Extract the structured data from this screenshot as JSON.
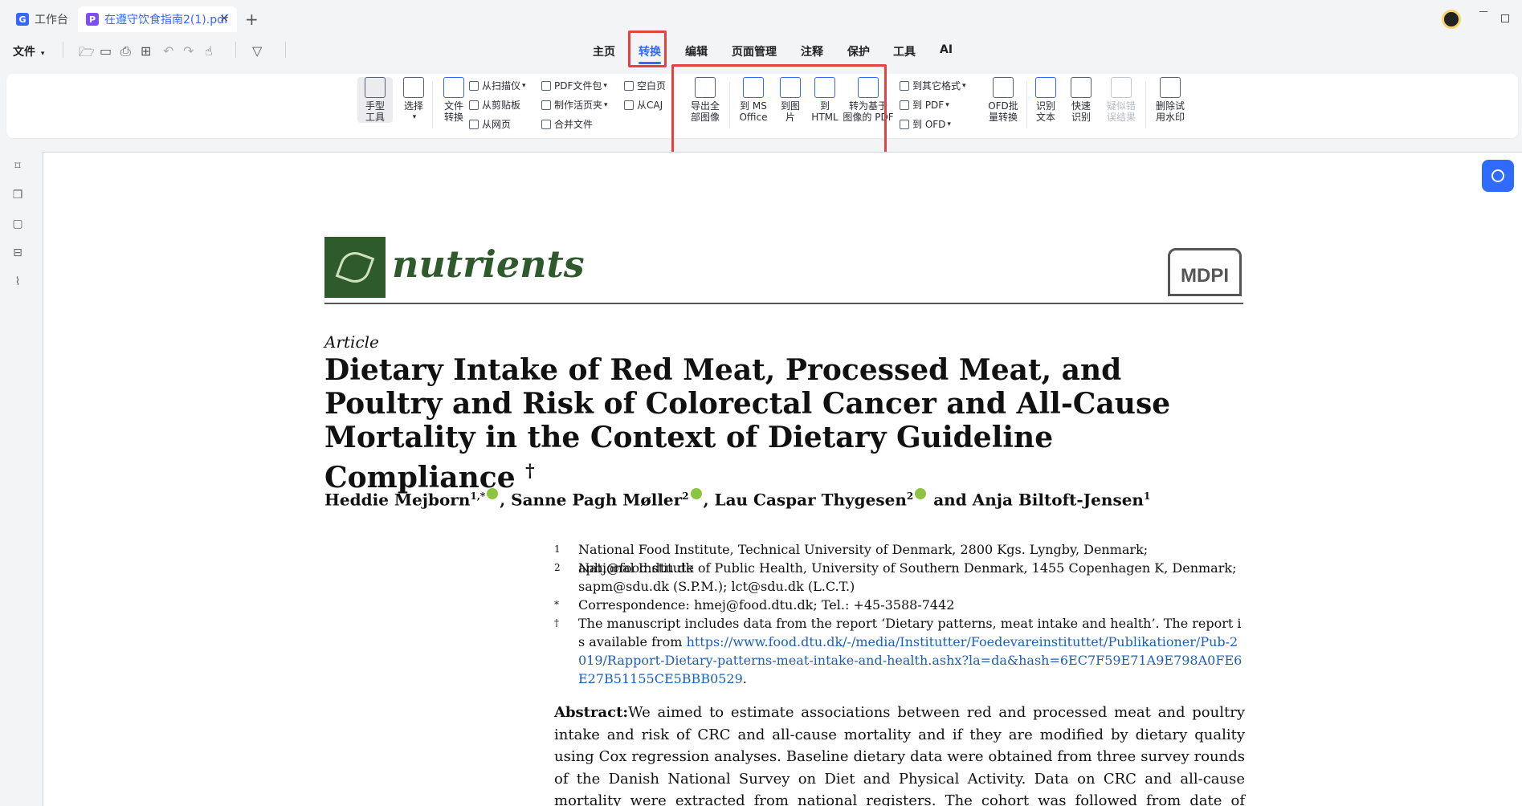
{
  "tabs": [
    {
      "label": "工作台"
    },
    {
      "label": "在遵守饮食指南2(1).pdf"
    }
  ],
  "tab_close": "×",
  "tab_add": "+",
  "menu": {
    "file_label": "文件",
    "tabs": [
      "主页",
      "转换",
      "编辑",
      "页面管理",
      "注释",
      "保护",
      "工具",
      "AI"
    ],
    "active_tab": "转换"
  },
  "ribbon": {
    "hand_tool": "手型\n工具",
    "select": "选择",
    "file_convert": "文件\n转换",
    "from_scanner": "从扫描仪",
    "from_clipboard": "从剪贴板",
    "from_webpage": "从网页",
    "pdf_portfolio": "PDF文件包",
    "make_active_page": "制作活页夹",
    "merge_files": "合并文件",
    "blank_page": "空白页",
    "from_caj": "从CAJ",
    "export_all_images": "导出全\n部图像",
    "to_ms_office": "到 MS\nOffice",
    "to_image": "到图\n片",
    "to_html": "到\nHTML",
    "to_image_pdf": "转为基于\n图像的 PDF",
    "to_other_formats": "到其它格式",
    "to_pdf": "到 PDF",
    "to_ofd": "到 OFD",
    "ofd_batch": "OFD批\n量转换",
    "ocr_text": "识别\n文本",
    "quick_ocr": "快速\n识别",
    "suspected_errors": "疑似错\n误结果",
    "remove_watermark": "删除试\n用水印"
  },
  "document": {
    "journal": "nutrients",
    "publisher": "MDPI",
    "article_type": "Article",
    "title": "Dietary Intake of Red Meat, Processed Meat, and Poultry and Risk of Colorectal Cancer and All-Cause Mortality in the Context of Dietary Guideline Compliance",
    "title_mark": "†",
    "authors": [
      {
        "name": "Heddie Mejborn",
        "sup": "1,*"
      },
      {
        "name": "Sanne Pagh Møller",
        "sup": "2"
      },
      {
        "name": "Lau Caspar Thygesen",
        "sup": "2"
      },
      {
        "name": "Anja Biltoft-Jensen",
        "sup": "1"
      }
    ],
    "author_sep": ", ",
    "author_and": " and ",
    "affiliations": [
      {
        "mark": "1",
        "text": "National Food Institute, Technical University of Denmark, 2800 Kgs. Lyngby, Denmark; apbj@food.dtu.dk"
      },
      {
        "mark": "2",
        "text": "National Institute of Public Health, University of Southern Denmark, 1455 Copenhagen K, Denmark; sapm@sdu.dk (S.P.M.); lct@sdu.dk (L.C.T.)"
      },
      {
        "mark": "*",
        "text": "Correspondence: hmej@food.dtu.dk; Tel.: +45-3588-7442"
      }
    ],
    "note_mark": "†",
    "note_text": "The manuscript includes data from the report ‘Dietary patterns, meat intake and health’. The report is available from ",
    "note_link": "https://www.food.dtu.dk/-/media/Institutter/Foedevareinstituttet/Publikationer/Pub-2019/Rapport-Dietary-patterns-meat-intake-and-health.ashx?la=da&hash=6EC7F59E71A9E798A0FE6E27B51155CE5BBB0529",
    "note_end": ".",
    "abstract_label": "Abstract:",
    "abstract_text": "We aimed to estimate associations between red and processed meat and poultry intake and risk of CRC and all-cause mortality and if they are   modified by dietary quality using Cox regression analyses.  Baseline dietary data were obtained              from three survey rounds of the Danish National Survey on Diet and Physical Activity.  Data on             CRC and all-cause mortality were extracted from national registers.  The cohort was followed from                     date of survey"
  },
  "colors": {
    "accent": "#2f6bff",
    "highlight": "#e5413e",
    "journal_green": "#2f5b2c"
  }
}
